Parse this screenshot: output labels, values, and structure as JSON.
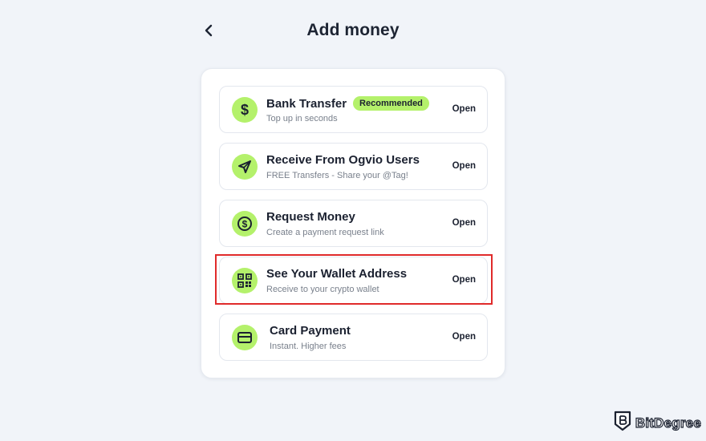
{
  "header": {
    "title": "Add money",
    "back_icon": "chevron-left-icon"
  },
  "options": [
    {
      "title": "Bank Transfer",
      "badge": "Recommended",
      "subtitle": "Top up in seconds",
      "action": "Open",
      "icon": "dollar-icon"
    },
    {
      "title": "Receive From Ogvio Users",
      "subtitle": "FREE Transfers - Share your @Tag!",
      "action": "Open",
      "icon": "send-icon"
    },
    {
      "title": "Request Money",
      "subtitle": "Create a payment request link",
      "action": "Open",
      "icon": "coin-icon"
    },
    {
      "title": "See Your Wallet Address",
      "subtitle": "Receive to your crypto wallet",
      "action": "Open",
      "icon": "qr-code-icon"
    },
    {
      "title": "Card Payment",
      "subtitle": "Instant. Higher fees",
      "action": "Open",
      "icon": "credit-card-icon"
    }
  ],
  "highlighted_option": "See Your Wallet Address",
  "watermark": {
    "text": "BitDegree",
    "icon": "bitdegree-logo-icon"
  },
  "colors": {
    "accent": "#b4f16b",
    "background": "#f1f4f9",
    "highlight_border": "#e02b2b",
    "text_primary": "#1b2130",
    "text_secondary": "#79808c"
  }
}
